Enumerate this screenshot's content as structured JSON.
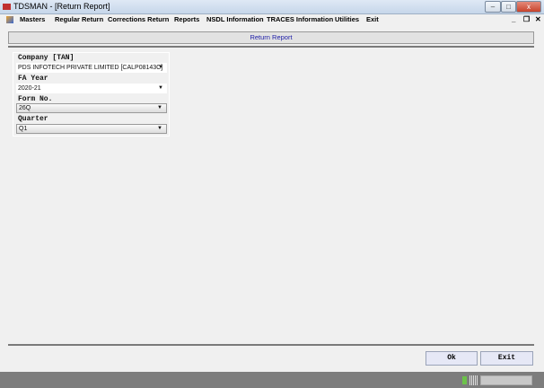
{
  "window": {
    "title": "TDSMAN - [Return Report]"
  },
  "menu": [
    "Masters",
    "Regular Return",
    "Corrections Return",
    "Reports",
    "NSDL Information",
    "TRACES Information",
    "Utilities",
    "Exit"
  ],
  "header": {
    "title": "Return Report"
  },
  "form": {
    "company_label": "Company [TAN]",
    "company_value": "PDS INFOTECH PRIVATE LIMITED [CALP08143C]",
    "fa_year_label": "FA Year",
    "fa_year_value": "2020-21",
    "form_no_label": "Form No.",
    "form_no_value": "26Q",
    "quarter_label": "Quarter",
    "quarter_value": "Q1"
  },
  "buttons": {
    "ok": "Ok",
    "exit": "Exit"
  }
}
